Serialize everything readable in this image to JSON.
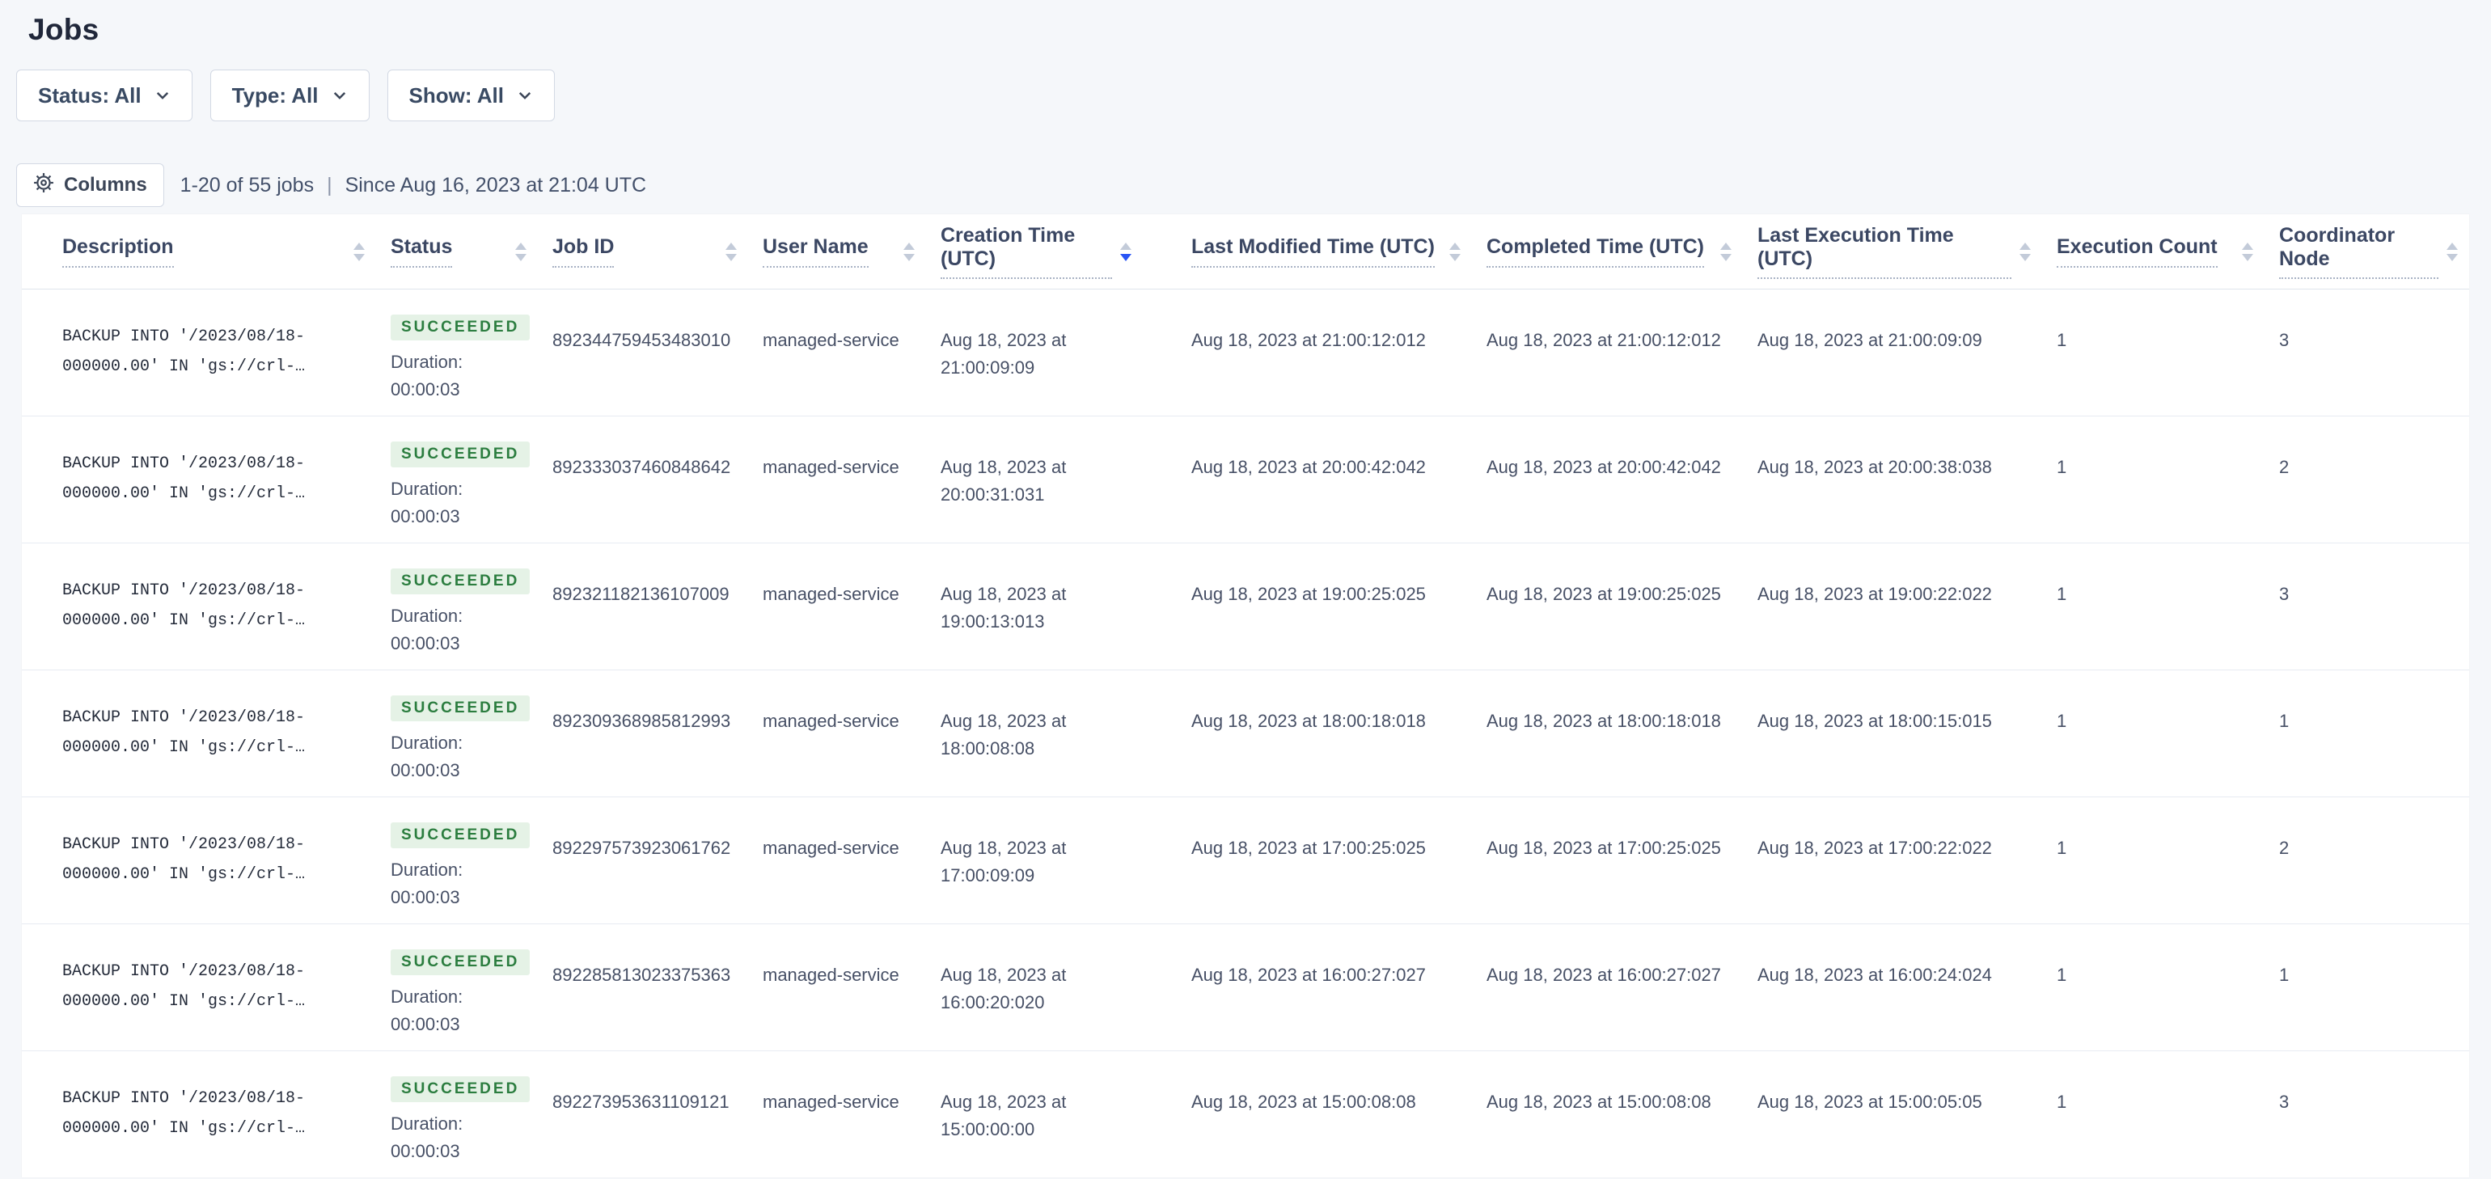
{
  "page": {
    "title": "Jobs"
  },
  "colors": {
    "page_background": "#f5f7fa",
    "accent_sort_active": "#2955f5",
    "status_succeeded_text": "#2b7d3f",
    "status_succeeded_background": "#e5f2e6"
  },
  "filters": [
    {
      "label": "Status: All"
    },
    {
      "label": "Type: All"
    },
    {
      "label": "Show: All"
    }
  ],
  "toolbar": {
    "columns_label": "Columns",
    "count_text": "1-20 of 55 jobs",
    "separator": "|",
    "since_text": "Since Aug 16, 2023 at 21:04 UTC"
  },
  "table": {
    "columns": [
      {
        "label": "Description",
        "sort": "none"
      },
      {
        "label": "Status",
        "sort": "none"
      },
      {
        "label": "Job ID",
        "sort": "none"
      },
      {
        "label": "User Name",
        "sort": "none"
      },
      {
        "label": "Creation Time (UTC)",
        "sort": "desc"
      },
      {
        "label": "Last Modified Time (UTC)",
        "sort": "none"
      },
      {
        "label": "Completed Time (UTC)",
        "sort": "none"
      },
      {
        "label": "Last Execution Time (UTC)",
        "sort": "none"
      },
      {
        "label": "Execution Count",
        "sort": "none"
      },
      {
        "label": "Coordinator Node",
        "sort": "none"
      }
    ],
    "rows": [
      {
        "description_line1": "BACKUP INTO '/2023/08/18-",
        "description_line2": "000000.00' IN 'gs://crl-…",
        "status": "SUCCEEDED",
        "duration_label": "Duration:",
        "duration": "00:00:03",
        "job_id": "892344759453483010",
        "user_name": "managed-service",
        "creation_time": "Aug 18, 2023 at 21:00:09:09",
        "last_modified_time": "Aug 18, 2023 at 21:00:12:012",
        "completed_time": "Aug 18, 2023 at 21:00:12:012",
        "last_execution_time": "Aug 18, 2023 at 21:00:09:09",
        "execution_count": "1",
        "coordinator_node": "3"
      },
      {
        "description_line1": "BACKUP INTO '/2023/08/18-",
        "description_line2": "000000.00' IN 'gs://crl-…",
        "status": "SUCCEEDED",
        "duration_label": "Duration:",
        "duration": "00:00:03",
        "job_id": "892333037460848642",
        "user_name": "managed-service",
        "creation_time": "Aug 18, 2023 at 20:00:31:031",
        "last_modified_time": "Aug 18, 2023 at 20:00:42:042",
        "completed_time": "Aug 18, 2023 at 20:00:42:042",
        "last_execution_time": "Aug 18, 2023 at 20:00:38:038",
        "execution_count": "1",
        "coordinator_node": "2"
      },
      {
        "description_line1": "BACKUP INTO '/2023/08/18-",
        "description_line2": "000000.00' IN 'gs://crl-…",
        "status": "SUCCEEDED",
        "duration_label": "Duration:",
        "duration": "00:00:03",
        "job_id": "892321182136107009",
        "user_name": "managed-service",
        "creation_time": "Aug 18, 2023 at 19:00:13:013",
        "last_modified_time": "Aug 18, 2023 at 19:00:25:025",
        "completed_time": "Aug 18, 2023 at 19:00:25:025",
        "last_execution_time": "Aug 18, 2023 at 19:00:22:022",
        "execution_count": "1",
        "coordinator_node": "3"
      },
      {
        "description_line1": "BACKUP INTO '/2023/08/18-",
        "description_line2": "000000.00' IN 'gs://crl-…",
        "status": "SUCCEEDED",
        "duration_label": "Duration:",
        "duration": "00:00:03",
        "job_id": "892309368985812993",
        "user_name": "managed-service",
        "creation_time": "Aug 18, 2023 at 18:00:08:08",
        "last_modified_time": "Aug 18, 2023 at 18:00:18:018",
        "completed_time": "Aug 18, 2023 at 18:00:18:018",
        "last_execution_time": "Aug 18, 2023 at 18:00:15:015",
        "execution_count": "1",
        "coordinator_node": "1"
      },
      {
        "description_line1": "BACKUP INTO '/2023/08/18-",
        "description_line2": "000000.00' IN 'gs://crl-…",
        "status": "SUCCEEDED",
        "duration_label": "Duration:",
        "duration": "00:00:03",
        "job_id": "892297573923061762",
        "user_name": "managed-service",
        "creation_time": "Aug 18, 2023 at 17:00:09:09",
        "last_modified_time": "Aug 18, 2023 at 17:00:25:025",
        "completed_time": "Aug 18, 2023 at 17:00:25:025",
        "last_execution_time": "Aug 18, 2023 at 17:00:22:022",
        "execution_count": "1",
        "coordinator_node": "2"
      },
      {
        "description_line1": "BACKUP INTO '/2023/08/18-",
        "description_line2": "000000.00' IN 'gs://crl-…",
        "status": "SUCCEEDED",
        "duration_label": "Duration:",
        "duration": "00:00:03",
        "job_id": "892285813023375363",
        "user_name": "managed-service",
        "creation_time": "Aug 18, 2023 at 16:00:20:020",
        "last_modified_time": "Aug 18, 2023 at 16:00:27:027",
        "completed_time": "Aug 18, 2023 at 16:00:27:027",
        "last_execution_time": "Aug 18, 2023 at 16:00:24:024",
        "execution_count": "1",
        "coordinator_node": "1"
      },
      {
        "description_line1": "BACKUP INTO '/2023/08/18-",
        "description_line2": "000000.00' IN 'gs://crl-…",
        "status": "SUCCEEDED",
        "duration_label": "Duration:",
        "duration": "00:00:03",
        "job_id": "892273953631109121",
        "user_name": "managed-service",
        "creation_time": "Aug 18, 2023 at 15:00:00:00",
        "last_modified_time": "Aug 18, 2023 at 15:00:08:08",
        "completed_time": "Aug 18, 2023 at 15:00:08:08",
        "last_execution_time": "Aug 18, 2023 at 15:00:05:05",
        "execution_count": "1",
        "coordinator_node": "3"
      }
    ]
  }
}
